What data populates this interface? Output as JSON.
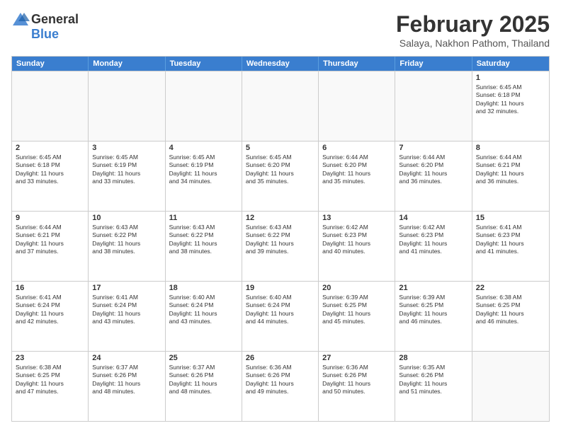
{
  "logo": {
    "general": "General",
    "blue": "Blue"
  },
  "title": "February 2025",
  "subtitle": "Salaya, Nakhon Pathom, Thailand",
  "header": {
    "days": [
      "Sunday",
      "Monday",
      "Tuesday",
      "Wednesday",
      "Thursday",
      "Friday",
      "Saturday"
    ]
  },
  "weeks": [
    [
      {
        "day": "",
        "empty": true
      },
      {
        "day": "",
        "empty": true
      },
      {
        "day": "",
        "empty": true
      },
      {
        "day": "",
        "empty": true
      },
      {
        "day": "",
        "empty": true
      },
      {
        "day": "",
        "empty": true
      },
      {
        "day": "1",
        "lines": [
          "Sunrise: 6:45 AM",
          "Sunset: 6:18 PM",
          "Daylight: 11 hours",
          "and 32 minutes."
        ]
      }
    ],
    [
      {
        "day": "2",
        "lines": [
          "Sunrise: 6:45 AM",
          "Sunset: 6:18 PM",
          "Daylight: 11 hours",
          "and 33 minutes."
        ]
      },
      {
        "day": "3",
        "lines": [
          "Sunrise: 6:45 AM",
          "Sunset: 6:19 PM",
          "Daylight: 11 hours",
          "and 33 minutes."
        ]
      },
      {
        "day": "4",
        "lines": [
          "Sunrise: 6:45 AM",
          "Sunset: 6:19 PM",
          "Daylight: 11 hours",
          "and 34 minutes."
        ]
      },
      {
        "day": "5",
        "lines": [
          "Sunrise: 6:45 AM",
          "Sunset: 6:20 PM",
          "Daylight: 11 hours",
          "and 35 minutes."
        ]
      },
      {
        "day": "6",
        "lines": [
          "Sunrise: 6:44 AM",
          "Sunset: 6:20 PM",
          "Daylight: 11 hours",
          "and 35 minutes."
        ]
      },
      {
        "day": "7",
        "lines": [
          "Sunrise: 6:44 AM",
          "Sunset: 6:20 PM",
          "Daylight: 11 hours",
          "and 36 minutes."
        ]
      },
      {
        "day": "8",
        "lines": [
          "Sunrise: 6:44 AM",
          "Sunset: 6:21 PM",
          "Daylight: 11 hours",
          "and 36 minutes."
        ]
      }
    ],
    [
      {
        "day": "9",
        "lines": [
          "Sunrise: 6:44 AM",
          "Sunset: 6:21 PM",
          "Daylight: 11 hours",
          "and 37 minutes."
        ]
      },
      {
        "day": "10",
        "lines": [
          "Sunrise: 6:43 AM",
          "Sunset: 6:22 PM",
          "Daylight: 11 hours",
          "and 38 minutes."
        ]
      },
      {
        "day": "11",
        "lines": [
          "Sunrise: 6:43 AM",
          "Sunset: 6:22 PM",
          "Daylight: 11 hours",
          "and 38 minutes."
        ]
      },
      {
        "day": "12",
        "lines": [
          "Sunrise: 6:43 AM",
          "Sunset: 6:22 PM",
          "Daylight: 11 hours",
          "and 39 minutes."
        ]
      },
      {
        "day": "13",
        "lines": [
          "Sunrise: 6:42 AM",
          "Sunset: 6:23 PM",
          "Daylight: 11 hours",
          "and 40 minutes."
        ]
      },
      {
        "day": "14",
        "lines": [
          "Sunrise: 6:42 AM",
          "Sunset: 6:23 PM",
          "Daylight: 11 hours",
          "and 41 minutes."
        ]
      },
      {
        "day": "15",
        "lines": [
          "Sunrise: 6:41 AM",
          "Sunset: 6:23 PM",
          "Daylight: 11 hours",
          "and 41 minutes."
        ]
      }
    ],
    [
      {
        "day": "16",
        "lines": [
          "Sunrise: 6:41 AM",
          "Sunset: 6:24 PM",
          "Daylight: 11 hours",
          "and 42 minutes."
        ]
      },
      {
        "day": "17",
        "lines": [
          "Sunrise: 6:41 AM",
          "Sunset: 6:24 PM",
          "Daylight: 11 hours",
          "and 43 minutes."
        ]
      },
      {
        "day": "18",
        "lines": [
          "Sunrise: 6:40 AM",
          "Sunset: 6:24 PM",
          "Daylight: 11 hours",
          "and 43 minutes."
        ]
      },
      {
        "day": "19",
        "lines": [
          "Sunrise: 6:40 AM",
          "Sunset: 6:24 PM",
          "Daylight: 11 hours",
          "and 44 minutes."
        ]
      },
      {
        "day": "20",
        "lines": [
          "Sunrise: 6:39 AM",
          "Sunset: 6:25 PM",
          "Daylight: 11 hours",
          "and 45 minutes."
        ]
      },
      {
        "day": "21",
        "lines": [
          "Sunrise: 6:39 AM",
          "Sunset: 6:25 PM",
          "Daylight: 11 hours",
          "and 46 minutes."
        ]
      },
      {
        "day": "22",
        "lines": [
          "Sunrise: 6:38 AM",
          "Sunset: 6:25 PM",
          "Daylight: 11 hours",
          "and 46 minutes."
        ]
      }
    ],
    [
      {
        "day": "23",
        "lines": [
          "Sunrise: 6:38 AM",
          "Sunset: 6:25 PM",
          "Daylight: 11 hours",
          "and 47 minutes."
        ]
      },
      {
        "day": "24",
        "lines": [
          "Sunrise: 6:37 AM",
          "Sunset: 6:26 PM",
          "Daylight: 11 hours",
          "and 48 minutes."
        ]
      },
      {
        "day": "25",
        "lines": [
          "Sunrise: 6:37 AM",
          "Sunset: 6:26 PM",
          "Daylight: 11 hours",
          "and 48 minutes."
        ]
      },
      {
        "day": "26",
        "lines": [
          "Sunrise: 6:36 AM",
          "Sunset: 6:26 PM",
          "Daylight: 11 hours",
          "and 49 minutes."
        ]
      },
      {
        "day": "27",
        "lines": [
          "Sunrise: 6:36 AM",
          "Sunset: 6:26 PM",
          "Daylight: 11 hours",
          "and 50 minutes."
        ]
      },
      {
        "day": "28",
        "lines": [
          "Sunrise: 6:35 AM",
          "Sunset: 6:26 PM",
          "Daylight: 11 hours",
          "and 51 minutes."
        ]
      },
      {
        "day": "",
        "empty": true
      }
    ]
  ]
}
